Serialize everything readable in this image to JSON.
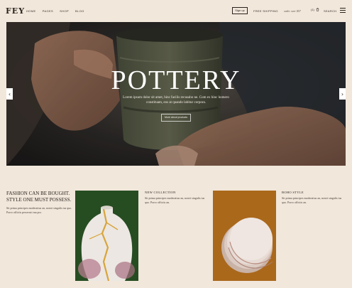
{
  "header": {
    "logo": "FEY",
    "nav": [
      "HOME",
      "PAGES",
      "SHOP",
      "BLOG"
    ],
    "signup_label": "Sign up",
    "free_shipping": "FREE SHIPPING",
    "order_over": "order over $57",
    "cart_count": "(1)",
    "search_label": "SEARCH"
  },
  "hero": {
    "title": "POTTERY",
    "description": "Lorem ipsum dolor sit amet, hinc facilis recusabo ne. Cum ex hinc homero constituam, eos at quando labitur corpora.",
    "button_label": "More about products",
    "prev_arrow": "‹",
    "next_arrow": "›"
  },
  "intro": {
    "heading": "FASHION CAN BE BOUGHT. STYLE ONE MUST POSSESS.",
    "body": "Sit prima principes moderatius an, nostri singulis ius quo. Porro officiis persecuti ma pro."
  },
  "cards": [
    {
      "title": "NEW COLLECTION",
      "desc": "Sit prima principes moderatius an, nostri singulis ius quo. Porro officiis an."
    },
    {
      "title": "BOHO STYLE",
      "desc": "Sit prima principes moderatius an, nostri singulis ius quo. Porro officiis an."
    }
  ],
  "colors": {
    "background": "#f1e7db",
    "text": "#2a221c",
    "card1_bg": "#264d22",
    "card2_bg": "#b5701e"
  },
  "icons": [
    "cart-icon",
    "menu-icon",
    "arrow-left-icon",
    "arrow-right-icon"
  ]
}
